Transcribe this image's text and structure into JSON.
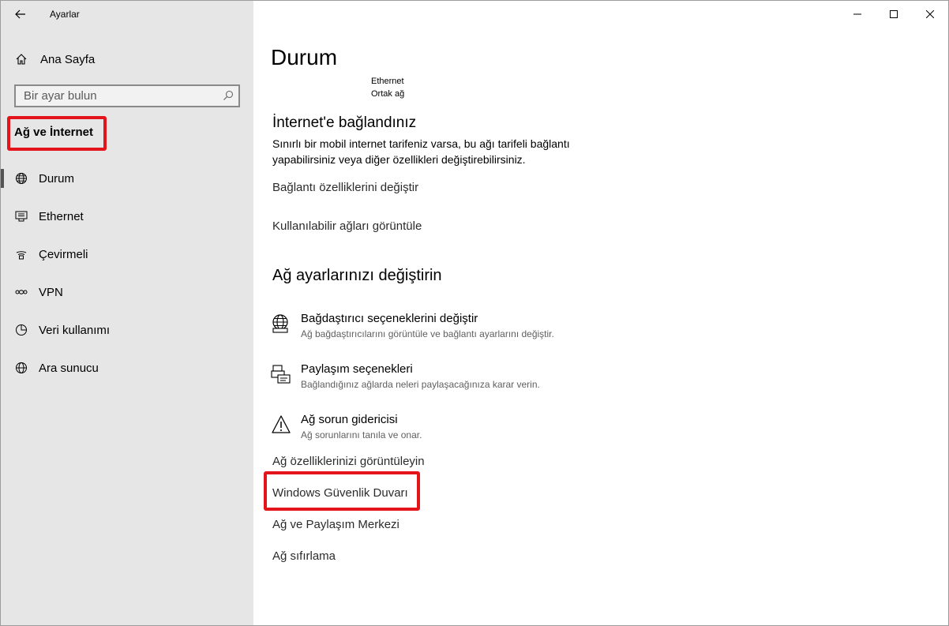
{
  "window": {
    "title": "Ayarlar"
  },
  "sidebar": {
    "home_label": "Ana Sayfa",
    "search_placeholder": "Bir ayar bulun",
    "section_label": "Ağ ve İnternet",
    "items": [
      {
        "label": "Durum",
        "icon": "globe-network-icon",
        "selected": true
      },
      {
        "label": "Ethernet",
        "icon": "ethernet-icon",
        "selected": false
      },
      {
        "label": "Çevirmeli",
        "icon": "dialup-icon",
        "selected": false
      },
      {
        "label": "VPN",
        "icon": "vpn-icon",
        "selected": false
      },
      {
        "label": "Veri kullanımı",
        "icon": "data-usage-icon",
        "selected": false
      },
      {
        "label": "Ara sunucu",
        "icon": "proxy-globe-icon",
        "selected": false
      }
    ]
  },
  "main": {
    "title": "Durum",
    "network": {
      "name": "Ethernet",
      "type": "Ortak ağ"
    },
    "connection": {
      "title": "İnternet'e bağlandınız",
      "description": "Sınırlı bir mobil internet tarifeniz varsa, bu ağı tarifeli bağlantı yapabilirsiniz veya diğer özellikleri değiştirebilirsiniz."
    },
    "links_top": [
      "Bağlantı özelliklerini değiştir",
      "Kullanılabilir ağları görüntüle"
    ],
    "change_section_title": "Ağ ayarlarınızı değiştirin",
    "options": [
      {
        "title": "Bağdaştırıcı seçeneklerini değiştir",
        "desc": "Ağ bağdaştırıcılarını görüntüle ve bağlantı ayarlarını değiştir.",
        "icon": "adapter-globe-icon"
      },
      {
        "title": "Paylaşım seçenekleri",
        "desc": "Bağlandığınız ağlarda neleri paylaşacağınıza karar verin.",
        "icon": "sharing-printer-icon"
      },
      {
        "title": "Ağ sorun gidericisi",
        "desc": "Ağ sorunlarını tanıla ve onar.",
        "icon": "warning-icon"
      }
    ],
    "links_bottom": [
      "Ağ özelliklerinizi görüntüleyin",
      "Windows Güvenlik Duvarı",
      "Ağ ve Paylaşım Merkezi",
      "Ağ sıfırlama"
    ]
  },
  "colors": {
    "sidebar_bg": "#e6e6e6",
    "highlight": "#e3151a",
    "selected_indicator": "#555555"
  }
}
